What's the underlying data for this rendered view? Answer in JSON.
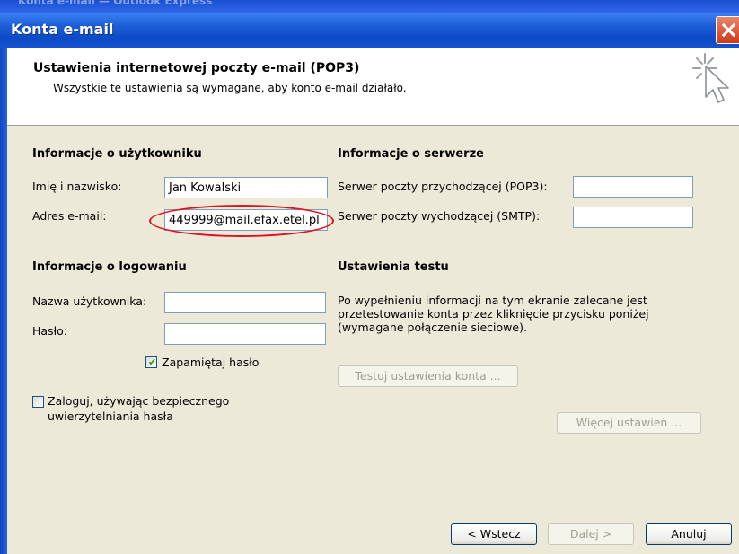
{
  "window": {
    "behind_title": "Konta e-mail — Outlook Express",
    "title": "Konta e-mail",
    "close_icon": "close-icon"
  },
  "header": {
    "title": "Ustawienia internetowej poczty e-mail (POP3)",
    "subtitle": "Wszystkie te ustawienia są wymagane, aby konto e-mail działało.",
    "icon": "wizard-cursor-icon"
  },
  "user_info": {
    "heading": "Informacje o użytkowniku",
    "name_label": "Imię i nazwisko:",
    "name_value": "Jan Kowalski",
    "email_label": "Adres e-mail:",
    "email_value": "449999@mail.efax.etel.pl"
  },
  "server_info": {
    "heading": "Informacje o serwerze",
    "incoming_label": "Serwer poczty przychodzącej (POP3):",
    "incoming_value": "",
    "outgoing_label": "Serwer poczty wychodzącej (SMTP):",
    "outgoing_value": ""
  },
  "logon_info": {
    "heading": "Informacje o logowaniu",
    "username_label": "Nazwa użytkownika:",
    "username_value": "",
    "password_label": "Hasło:",
    "password_value": "",
    "remember_label": "Zapamiętaj hasło",
    "remember_checked": true,
    "spa_label_line1": "Zaloguj, używając bezpiecznego",
    "spa_label_line2": "uwierzytelniania hasła",
    "spa_checked": false
  },
  "test_settings": {
    "heading": "Ustawienia testu",
    "description": "Po wypełnieniu informacji na tym ekranie zalecane jest przetestowanie konta przez kliknięcie przycisku poniżej (wymagane połączenie sieciowe).",
    "test_button": "Testuj ustawienia konta ...",
    "more_button": "Więcej ustawień ..."
  },
  "footer": {
    "back": "< Wstecz",
    "next": "Dalej >",
    "cancel": "Anuluj"
  },
  "annotation": {
    "color": "#e0141e"
  }
}
